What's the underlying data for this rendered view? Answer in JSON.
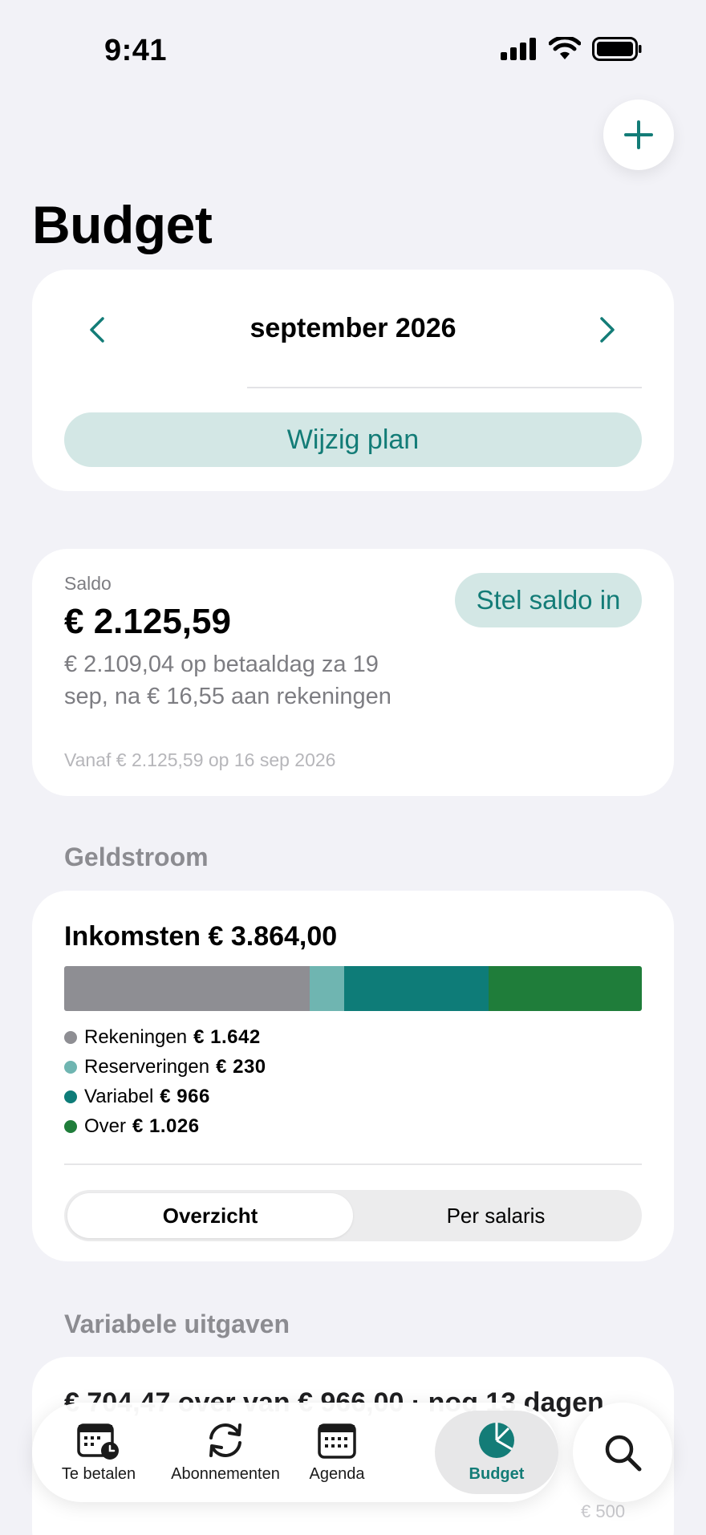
{
  "status_bar": {
    "time": "9:41"
  },
  "page": {
    "title": "Budget"
  },
  "month": {
    "label": "september 2026",
    "edit_plan": "Wijzig plan"
  },
  "saldo": {
    "label": "Saldo",
    "amount": "€ 2.125,59",
    "description": "€ 2.109,04 op betaaldag za 19 sep, na € 16,55 aan rekeningen",
    "since": "Vanaf € 2.125,59 op 16 sep 2026",
    "set_button": "Stel saldo in"
  },
  "geldstroom": {
    "section_title": "Geldstroom",
    "income": "Inkomsten € 3.864,00",
    "legend": [
      {
        "label": "Rekeningen",
        "value": "€ 1.642",
        "amount": 1642,
        "color": "#8e8e93"
      },
      {
        "label": "Reserveringen",
        "value": "€ 230",
        "amount": 230,
        "color": "#6fb5b1"
      },
      {
        "label": "Variabel",
        "value": "€ 966",
        "amount": 966,
        "color": "#0e7c78"
      },
      {
        "label": "Over",
        "value": "€ 1.026",
        "amount": 1026,
        "color": "#1f7d3a"
      }
    ],
    "segments": [
      "Overzicht",
      "Per salaris"
    ],
    "active_segment": "Overzicht"
  },
  "variabele": {
    "section_title": "Variabele uitgaven",
    "summary": "€ 704,47 over van € 966,00 · nog 13 dagen",
    "chart_label": "€ 500"
  },
  "tab_bar": {
    "tabs": [
      {
        "label": "Te betalen",
        "icon": "calendar-clock-icon"
      },
      {
        "label": "Abonnementen",
        "icon": "refresh-icon"
      },
      {
        "label": "Agenda",
        "icon": "calendar-icon"
      },
      {
        "label": "Budget",
        "icon": "pie-chart-icon",
        "active": true
      }
    ],
    "search_icon": "search-icon"
  },
  "colors": {
    "accent": "#137c77",
    "accent_soft": "#d3e7e5"
  }
}
